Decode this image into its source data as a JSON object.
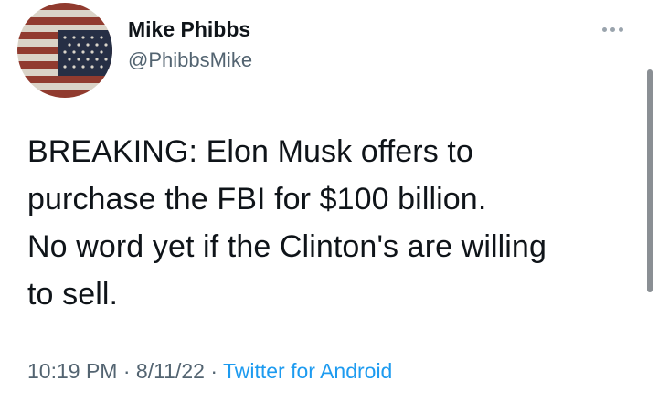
{
  "author": {
    "name": "Mike Phibbs",
    "handle": "@PhibbsMike",
    "avatar": "distressed-american-flag"
  },
  "menu": {
    "icon": "more-horizontal-icon"
  },
  "tweet": {
    "lines": [
      "BREAKING: Elon Musk offers to",
      "purchase the FBI for $100 billion.",
      "No word yet if the Clinton's are willing",
      "to sell."
    ]
  },
  "meta": {
    "time": "10:19 PM",
    "separator": "·",
    "date": "8/11/22",
    "source": "Twitter for Android"
  },
  "colors": {
    "text": "#0f1419",
    "secondary": "#536471",
    "link": "#1d9bf0",
    "background": "#ffffff"
  }
}
